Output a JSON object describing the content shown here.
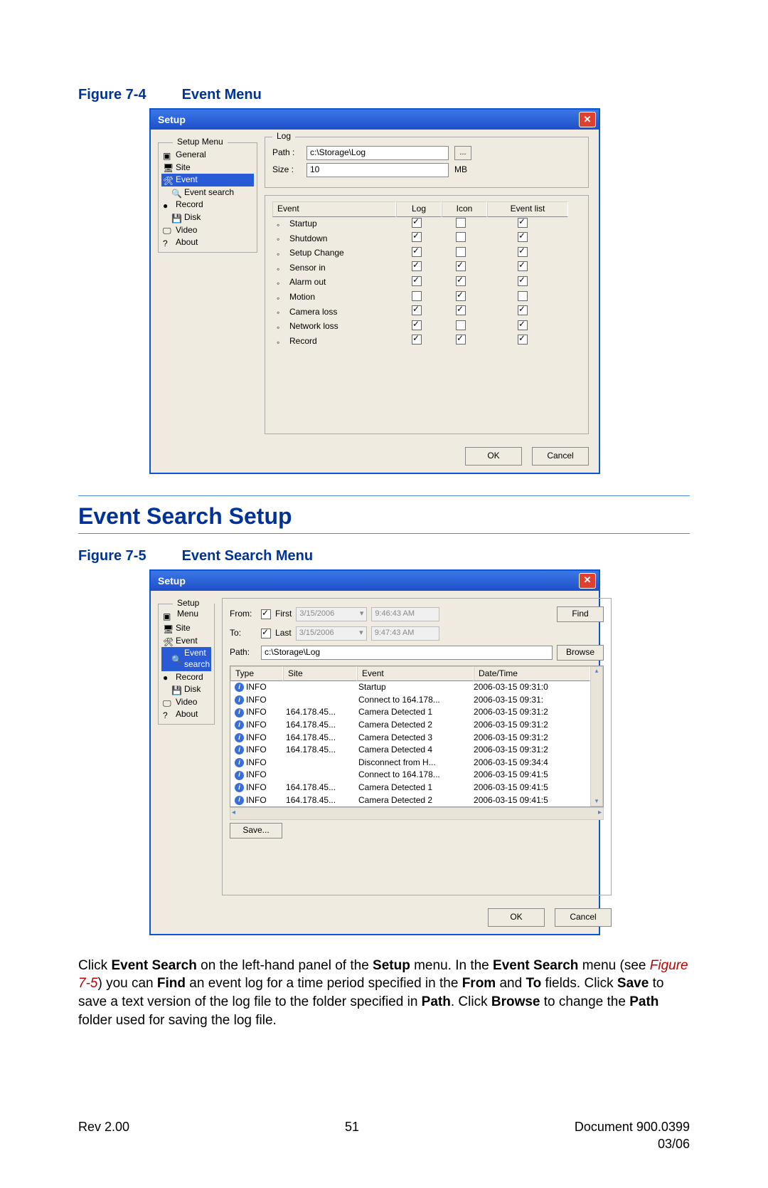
{
  "figure1": {
    "num": "Figure 7-4",
    "title": "Event Menu"
  },
  "dialog_title": "Setup",
  "sidebar_label": "Setup Menu",
  "sidebar_items": [
    "General",
    "Site",
    "Event",
    "Event search",
    "Record",
    "Disk",
    "Video",
    "About"
  ],
  "log_group": "Log",
  "path_label": "Path :",
  "path_value": "c:\\Storage\\Log",
  "size_label": "Size :",
  "size_value": "10",
  "size_unit": "MB",
  "evt_headers": [
    "Event",
    "Log",
    "Icon",
    "Event list"
  ],
  "events": [
    {
      "name": "Startup",
      "log": true,
      "icon": false,
      "elist": true
    },
    {
      "name": "Shutdown",
      "log": true,
      "icon": false,
      "elist": true
    },
    {
      "name": "Setup Change",
      "log": true,
      "icon": false,
      "elist": true
    },
    {
      "name": "Sensor in",
      "log": true,
      "icon": true,
      "elist": true
    },
    {
      "name": "Alarm out",
      "log": true,
      "icon": true,
      "elist": true
    },
    {
      "name": "Motion",
      "log": false,
      "icon": true,
      "elist": false
    },
    {
      "name": "Camera loss",
      "log": true,
      "icon": true,
      "elist": true
    },
    {
      "name": "Network loss",
      "log": true,
      "icon": false,
      "elist": true
    },
    {
      "name": "Record",
      "log": true,
      "icon": true,
      "elist": true
    }
  ],
  "ok": "OK",
  "cancel": "Cancel",
  "section_title": "Event Search Setup",
  "figure2": {
    "num": "Figure 7-5",
    "title": "Event Search Menu"
  },
  "srch": {
    "from": "From:",
    "to": "To:",
    "first": "First",
    "last": "Last",
    "date": "3/15/2006",
    "t1": "9:46:43 AM",
    "t2": "9:47:43 AM",
    "find": "Find",
    "path_label": "Path:",
    "path_value": "c:\\Storage\\Log",
    "browse": "Browse",
    "headers": [
      "Type",
      "Site",
      "Event",
      "Date/Time"
    ],
    "rows": [
      {
        "type": "INFO",
        "site": "",
        "event": "Startup",
        "dt": "2006-03-15 09:31:0"
      },
      {
        "type": "INFO",
        "site": "",
        "event": "Connect to 164.178...",
        "dt": "2006-03-15 09:31:"
      },
      {
        "type": "INFO",
        "site": "164.178.45...",
        "event": "Camera Detected 1",
        "dt": "2006-03-15 09:31:2"
      },
      {
        "type": "INFO",
        "site": "164.178.45...",
        "event": "Camera Detected 2",
        "dt": "2006-03-15 09:31:2"
      },
      {
        "type": "INFO",
        "site": "164.178.45...",
        "event": "Camera Detected 3",
        "dt": "2006-03-15 09:31:2"
      },
      {
        "type": "INFO",
        "site": "164.178.45...",
        "event": "Camera Detected 4",
        "dt": "2006-03-15 09:31:2"
      },
      {
        "type": "INFO",
        "site": "",
        "event": "Disconnect from H...",
        "dt": "2006-03-15 09:34:4"
      },
      {
        "type": "INFO",
        "site": "",
        "event": "Connect to 164.178...",
        "dt": "2006-03-15 09:41:5"
      },
      {
        "type": "INFO",
        "site": "164.178.45...",
        "event": "Camera Detected 1",
        "dt": "2006-03-15 09:41:5"
      },
      {
        "type": "INFO",
        "site": "164.178.45...",
        "event": "Camera Detected 2",
        "dt": "2006-03-15 09:41:5"
      }
    ],
    "save": "Save..."
  },
  "para_parts": {
    "t1": "Click ",
    "b1": "Event Search",
    "t2": " on the left-hand panel of the ",
    "b2": "Setup",
    "t3": " menu. In the ",
    "b3": "Event Search",
    "t4": " menu (see ",
    "ref": "Figure 7-5",
    "t5": ") you can ",
    "b4": "Find",
    "t6": " an event log for a time period specified in the ",
    "b5": "From",
    "t7": " and ",
    "b6": "To",
    "t8": " fields. Click ",
    "b7": "Save",
    "t9": " to save a text version of the log file to the folder specified in ",
    "b8": "Path",
    "t10": ". Click ",
    "b9": "Browse",
    "t11": " to change the ",
    "b10": "Path",
    "t12": " folder used for saving the log file."
  },
  "footer": {
    "rev": "Rev 2.00",
    "page": "51",
    "doc": "Document 900.0399",
    "date": "03/06"
  }
}
